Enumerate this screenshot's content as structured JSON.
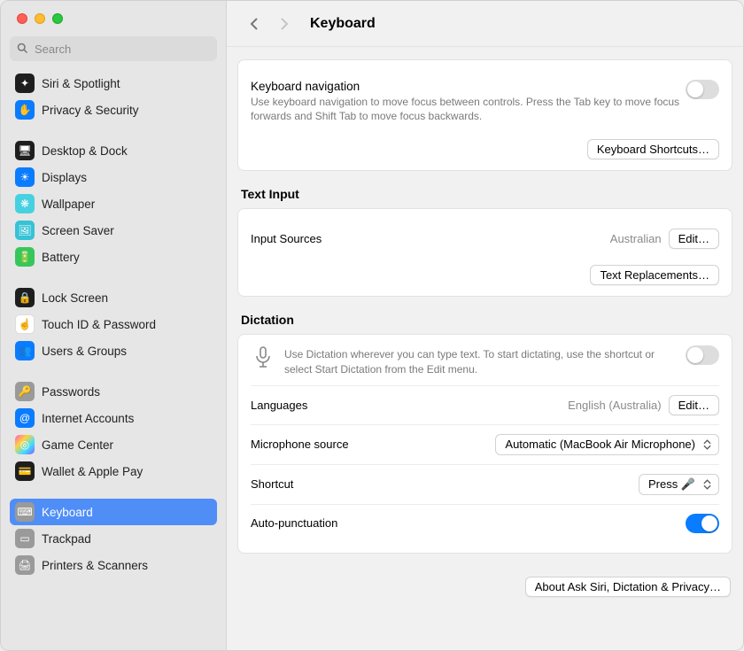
{
  "header": {
    "title": "Keyboard"
  },
  "search": {
    "placeholder": "Search"
  },
  "sidebar": {
    "items": [
      {
        "label": "Siri & Spotlight",
        "iconBg": "#1e1e1f",
        "glyph": "✦"
      },
      {
        "label": "Privacy & Security",
        "iconBg": "#0a7cff",
        "glyph": "✋"
      },
      {
        "label": "Desktop & Dock",
        "iconBg": "#1e1e1f",
        "glyph": "🖥"
      },
      {
        "label": "Displays",
        "iconBg": "#0a7cff",
        "glyph": "☀"
      },
      {
        "label": "Wallpaper",
        "iconBg": "#47d1e0",
        "glyph": "❋"
      },
      {
        "label": "Screen Saver",
        "iconBg": "#35c3d6",
        "glyph": "🖼"
      },
      {
        "label": "Battery",
        "iconBg": "#38c65b",
        "glyph": "🔋"
      },
      {
        "label": "Lock Screen",
        "iconBg": "#1e1e1f",
        "glyph": "🔒"
      },
      {
        "label": "Touch ID & Password",
        "iconBg": "#ffffff",
        "glyph": "☝",
        "fg": "#e03a3a"
      },
      {
        "label": "Users & Groups",
        "iconBg": "#0a7cff",
        "glyph": "👥"
      },
      {
        "label": "Passwords",
        "iconBg": "#9a9a9a",
        "glyph": "🔑"
      },
      {
        "label": "Internet Accounts",
        "iconBg": "#0a7cff",
        "glyph": "@"
      },
      {
        "label": "Game Center",
        "iconBg": "linear-gradient(135deg,#ff5cc4,#ffd23f,#3fe0ff,#8a5cff)",
        "glyph": "◎"
      },
      {
        "label": "Wallet & Apple Pay",
        "iconBg": "#1e1e1f",
        "glyph": "💳"
      },
      {
        "label": "Keyboard",
        "iconBg": "#9a9a9a",
        "glyph": "⌨",
        "selected": true
      },
      {
        "label": "Trackpad",
        "iconBg": "#9a9a9a",
        "glyph": "▭"
      },
      {
        "label": "Printers & Scanners",
        "iconBg": "#9a9a9a",
        "glyph": "🖨"
      }
    ],
    "gapsAfter": [
      1,
      6,
      9,
      13
    ]
  },
  "keyboardNav": {
    "title": "Keyboard navigation",
    "desc": "Use keyboard navigation to move focus between controls. Press the Tab key to move focus forwards and Shift Tab to move focus backwards.",
    "shortcutsBtn": "Keyboard Shortcuts…",
    "enabled": false
  },
  "textInput": {
    "section": "Text Input",
    "inputSourcesLabel": "Input Sources",
    "inputSourcesValue": "Australian",
    "editBtn": "Edit…",
    "textReplacementsBtn": "Text Replacements…"
  },
  "dictation": {
    "section": "Dictation",
    "blurb": "Use Dictation wherever you can type text. To start dictating, use the shortcut or select Start Dictation from the Edit menu.",
    "enabled": false,
    "languagesLabel": "Languages",
    "languagesValue": "English (Australia)",
    "languagesEditBtn": "Edit…",
    "micSourceLabel": "Microphone source",
    "micSourceValue": "Automatic (MacBook Air Microphone)",
    "shortcutLabel": "Shortcut",
    "shortcutValue": "Press 🎤",
    "autoPuncLabel": "Auto-punctuation",
    "autoPuncEnabled": true,
    "privacyBtn": "About Ask Siri, Dictation & Privacy…"
  }
}
